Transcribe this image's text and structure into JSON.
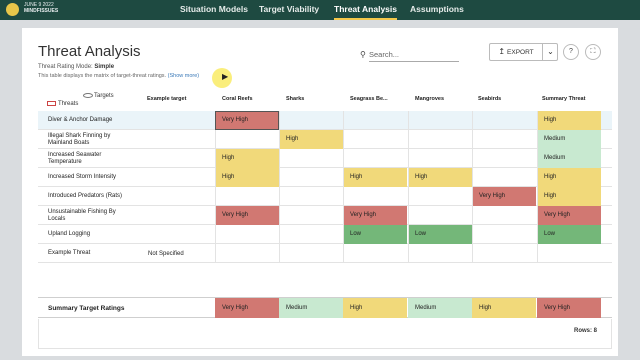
{
  "colors": {
    "very_high": "#d17872",
    "high": "#f1d97a",
    "medium": "#c8e9d0",
    "low": "#74b779",
    "topbar": "#1e4a41",
    "active_tab_underline": "#f4c84a"
  },
  "header": {
    "date": "JUNE 9 2022",
    "project_name": "MINDFISSUES",
    "nav": [
      "Situation Models",
      "Target Viability",
      "Threat Analysis",
      "Assumptions"
    ],
    "active_nav": "Threat Analysis"
  },
  "page": {
    "title": "Threat Analysis",
    "mode_label": "Threat Rating Mode:",
    "mode_value": "Simple",
    "description": "This table displays the matrix of target-threat ratings.",
    "show_more": "Show more",
    "search_placeholder": "Search...",
    "export_label": "EXPORT",
    "help": "?",
    "expand_icon": "fullscreen-icon"
  },
  "legend": {
    "targets": "Targets",
    "threats": "Threats"
  },
  "columns": [
    "Example target",
    "Coral Reefs",
    "Sharks",
    "Seagrass Be...",
    "Mangroves",
    "Seabirds",
    "Summary Threat"
  ],
  "rows": [
    {
      "threat": "Diver & Anchor Damage",
      "target": "",
      "ratings": [
        "Very High",
        "",
        "",
        "",
        "",
        "High"
      ],
      "selected": true
    },
    {
      "threat": "Illegal Shark Finning by Mainland Boats",
      "target": "",
      "ratings": [
        "",
        "High",
        "",
        "",
        "",
        "Medium"
      ]
    },
    {
      "threat": "Increased Seawater Temperature",
      "target": "",
      "ratings": [
        "High",
        "",
        "",
        "",
        "",
        "Medium"
      ]
    },
    {
      "threat": "Increased Storm Intensity",
      "target": "",
      "ratings": [
        "High",
        "",
        "High",
        "High",
        "",
        "High"
      ]
    },
    {
      "threat": "Introduced Predators (Rats)",
      "target": "",
      "ratings": [
        "",
        "",
        "",
        "",
        "Very High",
        "High"
      ]
    },
    {
      "threat": "Unsustainable Fishing By Locals",
      "target": "",
      "ratings": [
        "Very High",
        "",
        "Very High",
        "",
        "",
        "Very High"
      ]
    },
    {
      "threat": "Upland Logging",
      "target": "",
      "ratings": [
        "",
        "",
        "Low",
        "Low",
        "",
        "Low"
      ]
    },
    {
      "threat": "Example Threat",
      "target": "Not Specified",
      "ratings": [
        "",
        "",
        "",
        "",
        "",
        ""
      ]
    }
  ],
  "summary": {
    "label": "Summary Target Ratings",
    "ratings": [
      "Very High",
      "Medium",
      "High",
      "Medium",
      "High",
      "Very High"
    ]
  },
  "footer": {
    "rows_count": "Rows: 8"
  }
}
